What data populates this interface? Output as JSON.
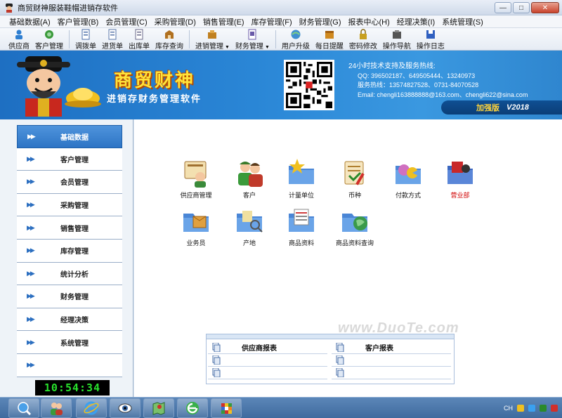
{
  "window": {
    "title": "商贸财神服装鞋帽进销存软件",
    "controls": [
      "minimize",
      "maximize",
      "close"
    ]
  },
  "menu": [
    "基础数据(A)",
    "客户管理(B)",
    "会员管理(C)",
    "采购管理(D)",
    "销售管理(E)",
    "库存管理(F)",
    "财务管理(G)",
    "报表中心(H)",
    "经理决策(I)",
    "系统管理(S)"
  ],
  "toolbar": [
    {
      "label": "供应商",
      "icon": "supplier-icon",
      "color": "#2f7fd1"
    },
    {
      "label": "客户管理",
      "icon": "customer-icon",
      "color": "#3a9a3a"
    },
    {
      "label": "调拨单",
      "icon": "transfer-icon",
      "color": "#4c6fa8"
    },
    {
      "label": "进货单",
      "icon": "purchase-icon",
      "color": "#5a77aa"
    },
    {
      "label": "出库单",
      "icon": "outbound-icon",
      "color": "#6a6a8a"
    },
    {
      "label": "库存查询",
      "icon": "inventory-icon",
      "color": "#b07020"
    },
    {
      "label": "进销管理",
      "icon": "trade-icon",
      "color": "#c08020",
      "dropdown": true
    },
    {
      "label": "财务管理",
      "icon": "finance-icon",
      "color": "#6a5aa8",
      "dropdown": true
    },
    {
      "label": "用户升级",
      "icon": "upgrade-icon",
      "color": "#3f8fd0"
    },
    {
      "label": "每日提醒",
      "icon": "reminder-icon",
      "color": "#d08a20"
    },
    {
      "label": "密码修改",
      "icon": "lock-icon",
      "color": "#c8a020"
    },
    {
      "label": "操作导航",
      "icon": "navigate-icon",
      "color": "#555555"
    },
    {
      "label": "操作日志",
      "icon": "log-icon",
      "color": "#3060c0"
    }
  ],
  "banner": {
    "brand": "商贸财神",
    "subtitle": "进销存财务管理软件",
    "support_title": "24小时技术支持及服务热线:",
    "qq": "QQ:  396502187、649505444、13240973",
    "hotline": "服务热线：13574827528、0731-84070528",
    "email": "Email:  chengli163888888@163.com、chengli622@sina.com",
    "edition": "加强版",
    "version": "V2018"
  },
  "nav": [
    {
      "label": "基础数据",
      "active": true
    },
    {
      "label": "客户管理",
      "active": false
    },
    {
      "label": "会员管理",
      "active": false
    },
    {
      "label": "采购管理",
      "active": false
    },
    {
      "label": "销售管理",
      "active": false
    },
    {
      "label": "库存管理",
      "active": false
    },
    {
      "label": "统计分析",
      "active": false
    },
    {
      "label": "财务管理",
      "active": false
    },
    {
      "label": "经理决策",
      "active": false
    },
    {
      "label": "系统管理",
      "active": false
    },
    {
      "label": "",
      "active": false
    }
  ],
  "clock": "10:54:34",
  "modules": [
    {
      "label": "供应商管理",
      "icon": "supplier-management-icon",
      "highlight": false
    },
    {
      "label": "客户",
      "icon": "customer-icon",
      "highlight": false
    },
    {
      "label": "计量单位",
      "icon": "unit-icon",
      "highlight": false
    },
    {
      "label": "币种",
      "icon": "currency-icon",
      "highlight": false
    },
    {
      "label": "付款方式",
      "icon": "payment-method-icon",
      "highlight": false
    },
    {
      "label": "营业部",
      "icon": "branch-icon",
      "highlight": true
    },
    {
      "label": "业务员",
      "icon": "salesperson-icon",
      "highlight": false
    },
    {
      "label": "产地",
      "icon": "origin-icon",
      "highlight": false
    },
    {
      "label": "商品资料",
      "icon": "product-data-icon",
      "highlight": false
    },
    {
      "label": "商品资料查询",
      "icon": "product-query-icon",
      "highlight": false
    }
  ],
  "watermark": "www.DuoTe.com",
  "reports": {
    "left": [
      "供应商报表",
      "",
      ""
    ],
    "right": [
      "客户报表",
      "",
      ""
    ]
  },
  "taskbar": [
    "search-icon",
    "users-icon",
    "ie-icon",
    "eye-icon",
    "map-icon",
    "browser-icon",
    "cube-icon"
  ],
  "tray": {
    "lang": "CH"
  }
}
